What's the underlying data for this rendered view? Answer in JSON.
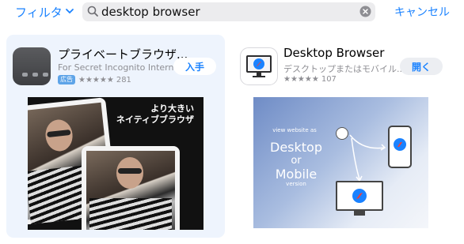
{
  "topbar": {
    "filter_label": "フィルタ",
    "search_value": "desktop browser",
    "cancel_label": "キャンセル"
  },
  "results": [
    {
      "title": "プライベートブラウザ...",
      "subtitle": "For Secret Incognito Internet",
      "ad_badge": "広告",
      "stars": "★★★★★",
      "rating_count": "281",
      "button_label": "入手",
      "screenshot_caption_line1": "より大きい",
      "screenshot_caption_line2": "ネイティブブラウザ"
    },
    {
      "title": "Desktop Browser",
      "subtitle": "デスクトップまたはモバイル...",
      "stars": "★★★★★",
      "rating_count": "107",
      "button_label": "開く",
      "screenshot_text": {
        "small": "view website as",
        "big1": "Desktop",
        "or": "or",
        "big2": "Mobile",
        "version": "version"
      }
    }
  ],
  "colors": {
    "accent": "#1a82ff",
    "card_bg": "#eef4fd",
    "search_bg": "#ececee"
  }
}
